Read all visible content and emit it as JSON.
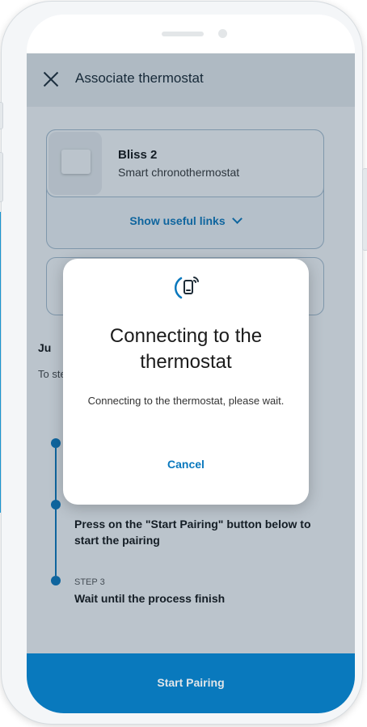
{
  "appbar": {
    "title": "Associate thermostat"
  },
  "device": {
    "name": "Bliss 2",
    "subtitle": "Smart chronothermostat",
    "links_label": "Show useful links"
  },
  "section": {
    "title_partial": "Ju",
    "desc_partial": "To ste"
  },
  "steps": [
    {
      "label": "",
      "text": ""
    },
    {
      "label": "",
      "text": "Press on the \"Start Pairing\" button below to start the pairing"
    },
    {
      "label": "STEP 3",
      "text": "Wait until the process finish"
    }
  ],
  "primary_button": {
    "label": "Start Pairing"
  },
  "dialog": {
    "title": "Connecting to the thermostat",
    "message": "Connecting to the thermostat, please wait.",
    "cancel_label": "Cancel"
  },
  "colors": {
    "accent": "#0a78bd",
    "button": "#0b84cd",
    "background_strip": "#1aa0e0"
  }
}
